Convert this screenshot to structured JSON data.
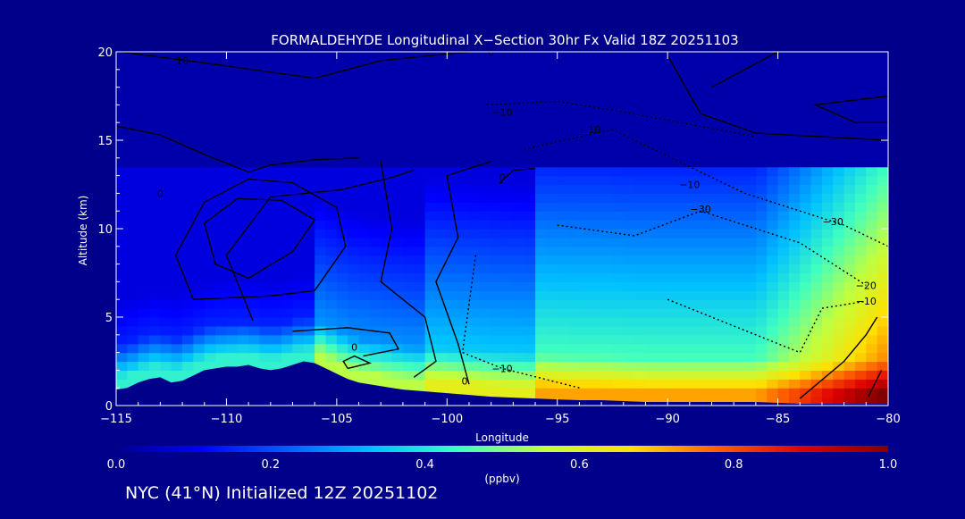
{
  "chart_data": {
    "type": "heatmap",
    "title": "FORMALDEHYDE Longitudinal X−Section 30hr  Fx Valid 18Z 20251103",
    "xlabel": "Longitude",
    "ylabel": "Altitude (km)",
    "xlim": [
      -115,
      -80
    ],
    "ylim": [
      0,
      20
    ],
    "x_ticks": [
      -115,
      -110,
      -105,
      -100,
      -95,
      -90,
      -85,
      -80
    ],
    "x_tick_labels": [
      "−115",
      "−110",
      "−105",
      "−100",
      "−95",
      "−90",
      "−85",
      "−80"
    ],
    "y_ticks": [
      0,
      5,
      10,
      15,
      20
    ],
    "y_tick_labels": [
      "0",
      "5",
      "10",
      "15",
      "20"
    ],
    "colorbar": {
      "label": "(ppbv)",
      "range": [
        0,
        1
      ],
      "ticks": [
        0,
        0.2,
        0.4,
        0.6,
        0.8,
        1.0
      ],
      "tick_labels": [
        "0.0",
        "0.2",
        "0.4",
        "0.6",
        "0.8",
        "1.0"
      ],
      "colors": [
        "#00008a",
        "#0000ff",
        "#0060ff",
        "#00c0ff",
        "#40ffc0",
        "#c0ff40",
        "#ffe000",
        "#ff6000",
        "#e00000",
        "#800000"
      ]
    },
    "terrain": {
      "lon": [
        -115,
        -114.5,
        -114,
        -113.5,
        -113,
        -112.5,
        -112,
        -111.5,
        -111,
        -110.5,
        -110,
        -109.5,
        -109,
        -108.5,
        -108,
        -107.5,
        -107,
        -106.5,
        -106,
        -105.5,
        -105,
        -104.5,
        -104,
        -103.5,
        -103,
        -102.5,
        -102,
        -101,
        -100,
        -99,
        -98,
        -97,
        -96,
        -95,
        -94,
        -93,
        -92,
        -91,
        -90,
        -89,
        -88,
        -87,
        -86,
        -85,
        -84,
        -83,
        -82,
        -81,
        -80
      ],
      "alt_km": [
        0.9,
        1.0,
        1.3,
        1.5,
        1.6,
        1.3,
        1.4,
        1.7,
        2.0,
        2.1,
        2.2,
        2.2,
        2.3,
        2.1,
        2.0,
        2.1,
        2.3,
        2.5,
        2.4,
        2.1,
        1.8,
        1.5,
        1.3,
        1.2,
        1.1,
        1.0,
        0.9,
        0.8,
        0.7,
        0.6,
        0.5,
        0.45,
        0.4,
        0.35,
        0.3,
        0.3,
        0.25,
        0.2,
        0.2,
        0.2,
        0.2,
        0.2,
        0.2,
        0.15,
        0.1,
        0.1,
        0.1,
        0.1,
        0.1
      ]
    },
    "field": {
      "description_units": "ppbv",
      "samples": [
        {
          "lon": -105,
          "alt_km": 2.3,
          "value": 0.55
        },
        {
          "lon": -103,
          "alt_km": 2.2,
          "value": 0.52
        },
        {
          "lon": -100,
          "alt_km": 1.3,
          "value": 0.6
        },
        {
          "lon": -95,
          "alt_km": 0.6,
          "value": 0.7
        },
        {
          "lon": -90,
          "alt_km": 0.5,
          "value": 0.75
        },
        {
          "lon": -84,
          "alt_km": 0.5,
          "value": 0.95
        },
        {
          "lon": -81,
          "alt_km": 0.6,
          "value": 1.0
        },
        {
          "lon": -110,
          "alt_km": 5,
          "value": 0.2
        },
        {
          "lon": -90,
          "alt_km": 5,
          "value": 0.15
        },
        {
          "lon": -100,
          "alt_km": 10,
          "value": 0.12
        },
        {
          "lon": -100,
          "alt_km": 16,
          "value": 0.05
        }
      ]
    },
    "contour_labels": [
      {
        "text": "10",
        "lon": -112,
        "alt_km": 19.5
      },
      {
        "text": "0",
        "lon": -113,
        "alt_km": 12
      },
      {
        "text": "0",
        "lon": -98,
        "alt_km": 20
      },
      {
        "text": "−10",
        "lon": -97.5,
        "alt_km": 16.6
      },
      {
        "text": "−10",
        "lon": -93.5,
        "alt_km": 15.6
      },
      {
        "text": "0",
        "lon": -97.5,
        "alt_km": 12.9
      },
      {
        "text": "−10",
        "lon": -89,
        "alt_km": 12.5
      },
      {
        "text": "−30",
        "lon": -88.5,
        "alt_km": 11.1
      },
      {
        "text": "−30",
        "lon": -82.5,
        "alt_km": 10.4
      },
      {
        "text": "−20",
        "lon": -81,
        "alt_km": 6.8
      },
      {
        "text": "−10",
        "lon": -81,
        "alt_km": 5.9
      },
      {
        "text": "0",
        "lon": -104.2,
        "alt_km": 3.3
      },
      {
        "text": "−10",
        "lon": -97.5,
        "alt_km": 2.1
      },
      {
        "text": "0",
        "lon": -99.2,
        "alt_km": 1.4
      }
    ],
    "grid": false,
    "legend": "colorbar-bottom"
  },
  "caption": "NYC (41°N) Initialized 12Z 20251102"
}
